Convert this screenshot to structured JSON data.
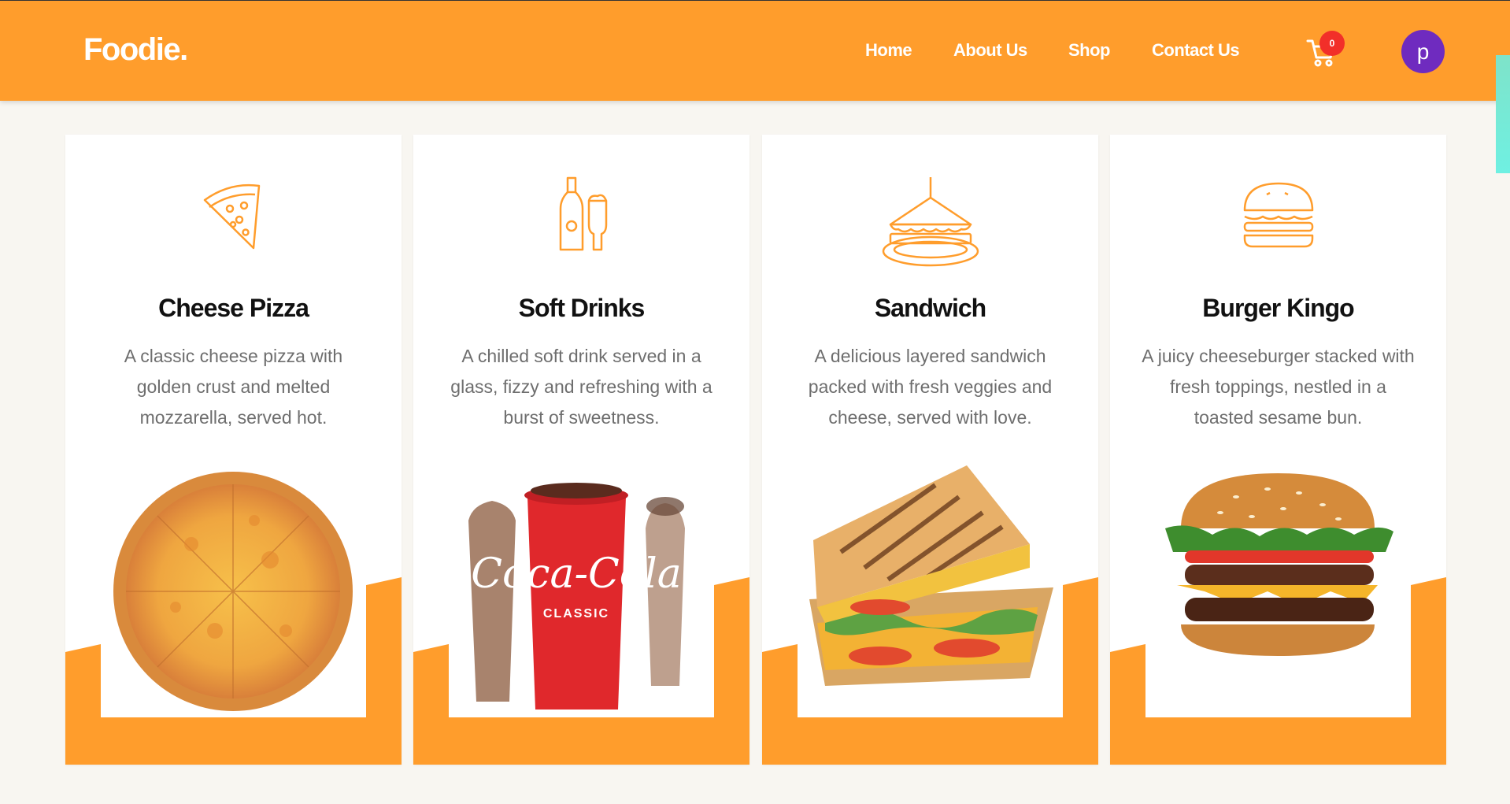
{
  "brand": {
    "logo": "Foodie."
  },
  "nav": {
    "links": [
      {
        "label": "Home"
      },
      {
        "label": "About Us"
      },
      {
        "label": "Shop"
      },
      {
        "label": "Contact Us"
      }
    ],
    "cart_count": "0",
    "avatar_initial": "p"
  },
  "colors": {
    "accent": "#ff9d2c",
    "badge": "#f22f29",
    "avatar": "#6f2bbf"
  },
  "cards": [
    {
      "icon": "pizza-slice-icon",
      "title": "Cheese Pizza",
      "description": "A classic cheese pizza with golden crust and melted mozzarella, served hot."
    },
    {
      "icon": "bottle-and-glass-icon",
      "title": "Soft Drinks",
      "description": "A chilled soft drink served in a glass, fizzy and refreshing with a burst of sweetness."
    },
    {
      "icon": "sandwich-icon",
      "title": "Sandwich",
      "description": "A delicious layered sandwich packed with fresh veggies and cheese, served with love."
    },
    {
      "icon": "burger-icon",
      "title": "Burger Kingo",
      "description": "A juicy cheeseburger stacked with fresh toppings, nestled in a toasted sesame bun."
    }
  ],
  "cup_text": {
    "brand": "Coca-Cola",
    "label": "CLASSIC"
  }
}
